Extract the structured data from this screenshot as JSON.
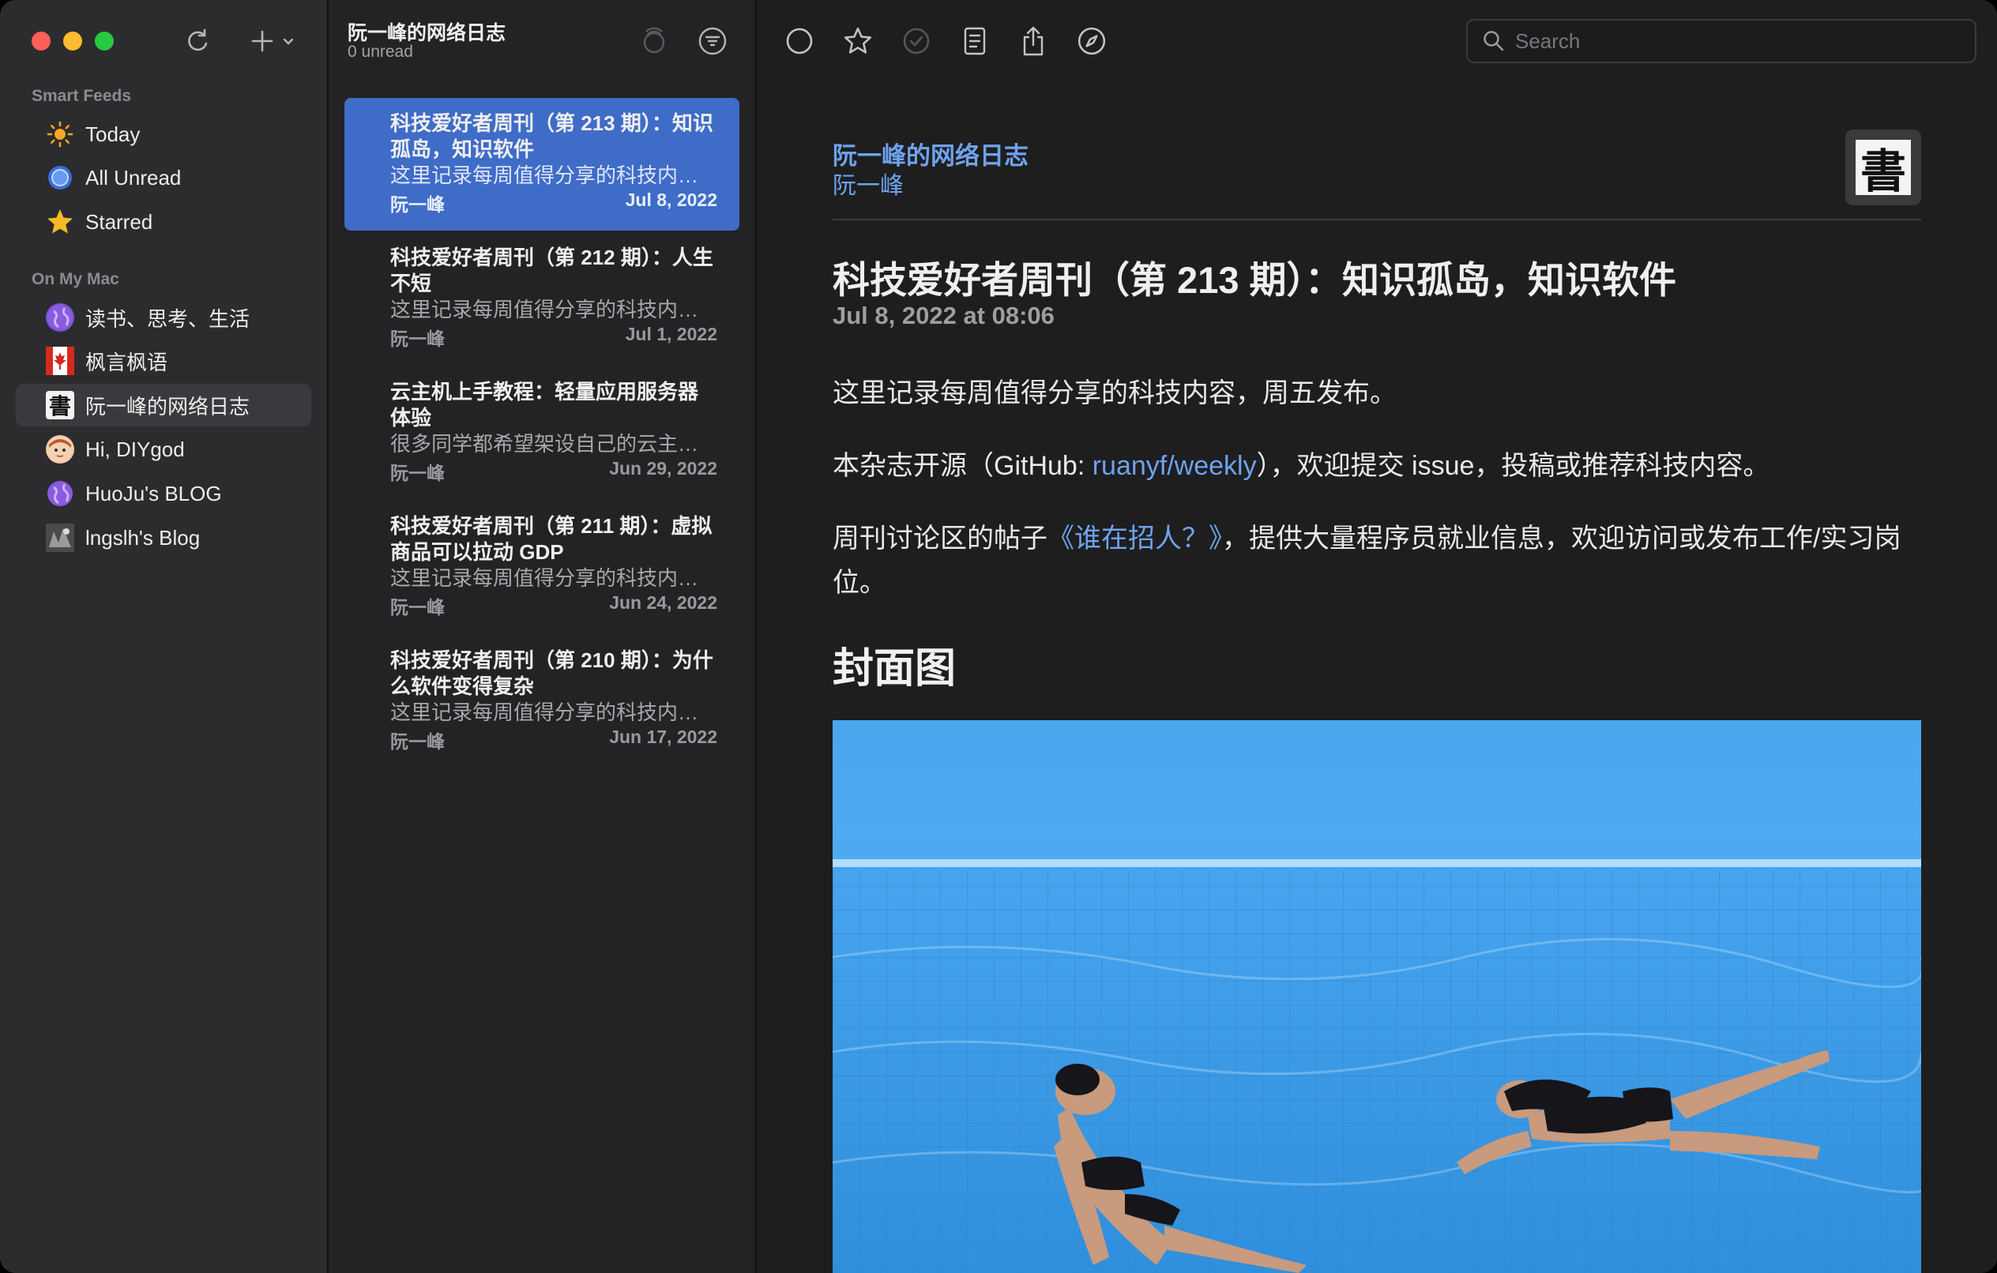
{
  "sidebar": {
    "smart_feeds_label": "Smart Feeds",
    "smart_feeds": [
      {
        "label": "Today",
        "icon": "sun-icon"
      },
      {
        "label": "All Unread",
        "icon": "unread-circle-icon"
      },
      {
        "label": "Starred",
        "icon": "star-icon"
      }
    ],
    "on_my_mac_label": "On My Mac",
    "feeds": [
      {
        "label": "读书、思考、生活",
        "icon": "globe-icon"
      },
      {
        "label": "枫言枫语",
        "icon": "maple-leaf-icon"
      },
      {
        "label": "阮一峰的网络日志",
        "icon": "calligraphy-icon",
        "selected": true
      },
      {
        "label": "Hi, DIYgod",
        "icon": "avatar-icon"
      },
      {
        "label": "HuoJu's BLOG",
        "icon": "globe-icon"
      },
      {
        "label": "lngslh's Blog",
        "icon": "avatar-icon"
      }
    ]
  },
  "list": {
    "title": "阮一峰的网络日志",
    "unread": "0 unread",
    "articles": [
      {
        "title": "科技爱好者周刊（第 213 期）：知识孤岛，知识软件",
        "summary": "这里记录每周值得分享的科技内容，周五发布。",
        "author": "阮一峰",
        "date": "Jul 8, 2022",
        "selected": true
      },
      {
        "title": "科技爱好者周刊（第 212 期）：人生不短",
        "summary": "这里记录每周值得分享的科技内容，周五发布。",
        "author": "阮一峰",
        "date": "Jul 1, 2022"
      },
      {
        "title": "云主机上手教程：轻量应用服务器体验",
        "summary": "很多同学都希望架设自己的云主机。",
        "author": "阮一峰",
        "date": "Jun 29, 2022"
      },
      {
        "title": "科技爱好者周刊（第 211 期）：虚拟商品可以拉动 GDP",
        "summary": "这里记录每周值得分享的科技内容，周五发布。",
        "author": "阮一峰",
        "date": "Jun 24, 2022"
      },
      {
        "title": "科技爱好者周刊（第 210 期）：为什么软件变得复杂",
        "summary": "这里记录每周值得分享的科技内容，周五发布。",
        "author": "阮一峰",
        "date": "Jun 17, 2022"
      }
    ]
  },
  "reader": {
    "search_placeholder": "Search",
    "feed_name": "阮一峰的网络日志",
    "author": "阮一峰",
    "logo_glyph": "書",
    "title": "科技爱好者周刊（第 213 期）：知识孤岛，知识软件",
    "date": "Jul 8, 2022 at 08:06",
    "para1": "这里记录每周值得分享的科技内容，周五发布。",
    "para2_prefix": "本杂志开源（GitHub: ",
    "para2_link": "ruanyf/weekly",
    "para2_suffix": "），欢迎提交 issue，投稿或推荐科技内容。",
    "para3_prefix": "周刊讨论区的帖子",
    "para3_link": "《谁在招人？》",
    "para3_suffix": "，提供大量程序员就业信息，欢迎访问或发布工作/实习岗位。",
    "cover_heading": "封面图"
  },
  "colors": {
    "accent": "#3f6cc7",
    "link": "#6ea3ee",
    "close": "#ff5f57",
    "minimize": "#febc2e",
    "maximize": "#28c840"
  }
}
